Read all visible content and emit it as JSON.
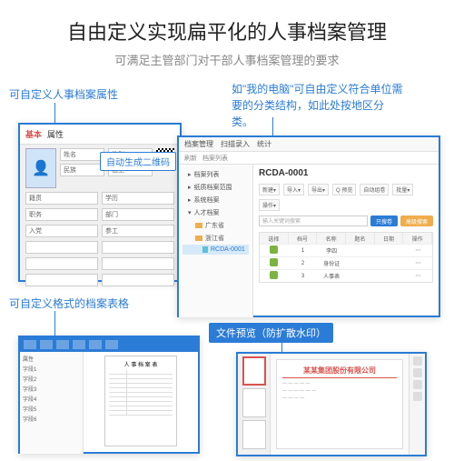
{
  "title": "自由定义实现扁平化的人事档案管理",
  "subtitle": "可满足主管部门对干部人事档案管理的要求",
  "labels": {
    "attr": "可自定义人事档案属性",
    "qr": "自动生成二维码",
    "region": "如\"我的电脑\"可自由定义符合单位需要的分类结构，如此处按地区分类。",
    "table": "可自定义格式的档案表格",
    "preview": "文件预览（防扩散水印）"
  },
  "p1": {
    "tabs": [
      "基本",
      "属性"
    ],
    "fields": [
      "姓名",
      "性别",
      "民族",
      "出生",
      "籍贯",
      "学历",
      "职务",
      "部门",
      "入党",
      "参工"
    ]
  },
  "p2": {
    "menu": [
      "档案管理",
      "扫描录入",
      "统计"
    ],
    "sub": [
      "刷新",
      "档案列表",
      "纸质档案范围",
      "系统档案",
      "人才档案"
    ],
    "tree_root": "人才档案",
    "tree_items": [
      "广东省",
      "浙江省"
    ],
    "tree_leaf": "RCDA-0001",
    "doc_title": "RCDA-0001",
    "toolbar": [
      "新建▾",
      "导入▾",
      "导出▾",
      "Q 预览",
      "自动组卷",
      "批量▾",
      "操作▾"
    ],
    "search_ph": "输入关键词搜索",
    "btn_search": "只搜卷",
    "btn_adv": "高级搜索",
    "cols": [
      "选择",
      "档号",
      "名称",
      "题名",
      "日期",
      "操作"
    ],
    "rows": [
      {
        "no": "1",
        "name": "李四",
        "date": ""
      },
      {
        "no": "2",
        "name": "身份证",
        "date": ""
      },
      {
        "no": "3",
        "name": "人事表",
        "date": ""
      }
    ]
  },
  "p3": {
    "left_items": [
      "属性",
      "字段1",
      "字段2",
      "字段3",
      "字段4",
      "字段5",
      "字段6"
    ],
    "doc_title": "人 事 档 案 表"
  },
  "p4": {
    "company": "某某集团股份有限公司"
  }
}
